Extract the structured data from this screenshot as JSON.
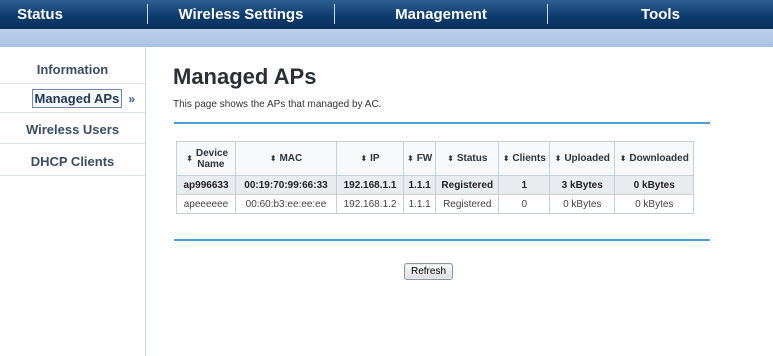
{
  "topnav": {
    "tabs": [
      {
        "label": "Status"
      },
      {
        "label": "Wireless Settings"
      },
      {
        "label": "Management"
      },
      {
        "label": "Tools"
      }
    ]
  },
  "sidebar": {
    "items": [
      {
        "label": "Information"
      },
      {
        "label": "Managed APs",
        "arrow": "»",
        "active": true
      },
      {
        "label": "Wireless Users"
      },
      {
        "label": "DHCP Clients"
      }
    ]
  },
  "main": {
    "title": "Managed APs",
    "description": "This page shows the APs that managed by AC.",
    "table": {
      "sort_icon": "⬍",
      "headers": [
        "Device Name",
        "MAC",
        "IP",
        "FW",
        "Status",
        "Clients",
        "Uploaded",
        "Downloaded"
      ],
      "rows": [
        [
          "ap996633",
          "00:19:70:99:66:33",
          "192.168.1.1",
          "1.1.1",
          "Registered",
          "1",
          "3 kBytes",
          "0 kBytes"
        ],
        [
          "apeeeeee",
          "00:60:b3:ee:ee:ee",
          "192.168.1.2",
          "1.1.1",
          "Registered",
          "0",
          "0 kBytes",
          "0 kBytes"
        ]
      ]
    },
    "refresh_label": "Refresh"
  },
  "colors": {
    "nav_bg": "#0f3c6d",
    "accent_line": "#4a9fd8",
    "strip": "#b3c9e8"
  }
}
